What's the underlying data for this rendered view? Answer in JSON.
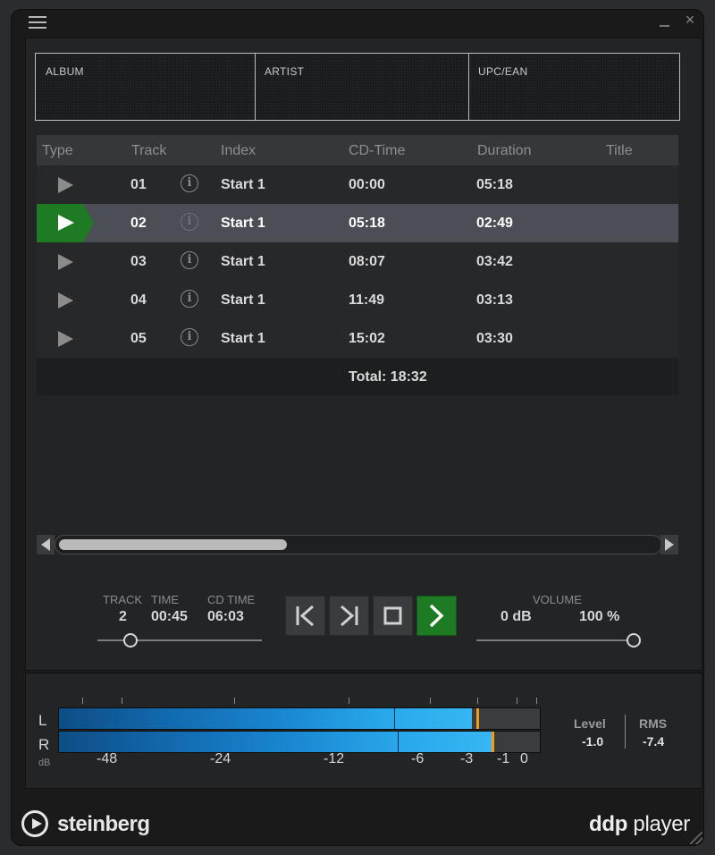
{
  "window": {
    "menu_icon": "hamburger-menu-icon",
    "minimize_icon": "minimize-icon",
    "close_symbol": "×"
  },
  "meta": {
    "album_label": "ALBUM",
    "artist_label": "ARTIST",
    "upc_label": "UPC/EAN"
  },
  "table": {
    "columns": [
      "Type",
      "Track",
      "Index",
      "CD-Time",
      "Duration",
      "Title"
    ],
    "rows": [
      {
        "track": "01",
        "index": "Start 1",
        "cd_time": "00:00",
        "duration": "05:18",
        "title": "",
        "selected": false
      },
      {
        "track": "02",
        "index": "Start 1",
        "cd_time": "05:18",
        "duration": "02:49",
        "title": "",
        "selected": true
      },
      {
        "track": "03",
        "index": "Start 1",
        "cd_time": "08:07",
        "duration": "03:42",
        "title": "",
        "selected": false
      },
      {
        "track": "04",
        "index": "Start 1",
        "cd_time": "11:49",
        "duration": "03:13",
        "title": "",
        "selected": false
      },
      {
        "track": "05",
        "index": "Start 1",
        "cd_time": "15:02",
        "duration": "03:30",
        "title": "",
        "selected": false
      }
    ],
    "total": "Total: 18:32",
    "info_symbol": "i"
  },
  "transport": {
    "track_label": "TRACK",
    "time_label": "TIME",
    "cdtime_label": "CD TIME",
    "track_value": "2",
    "time_value": "00:45",
    "cdtime_value": "06:03",
    "position_fraction": 0.2,
    "buttons": [
      "previous-track-icon",
      "next-track-icon",
      "stop-icon",
      "play-icon"
    ]
  },
  "volume": {
    "label": "VOLUME",
    "db_value": "0 dB",
    "percent_value": "100 %",
    "fraction": 1.0
  },
  "meter": {
    "l_label": "L",
    "r_label": "R",
    "db_label": "dB",
    "scale": [
      "-48",
      "-24",
      "-12",
      "-6",
      "-3",
      "-1",
      "0"
    ],
    "level_label": "Level",
    "level_value": "-1.0",
    "rms_label": "RMS",
    "rms_value": "-7.4",
    "colors": {
      "meter_blue": "#29a9ec",
      "peak": "#f29b1c"
    }
  },
  "footer": {
    "brand": "steinberg",
    "product_bold": "ddp",
    "product_rest": " player"
  },
  "colors": {
    "accent_green": "#1f7a24",
    "selected_row": "#4b4f55"
  }
}
